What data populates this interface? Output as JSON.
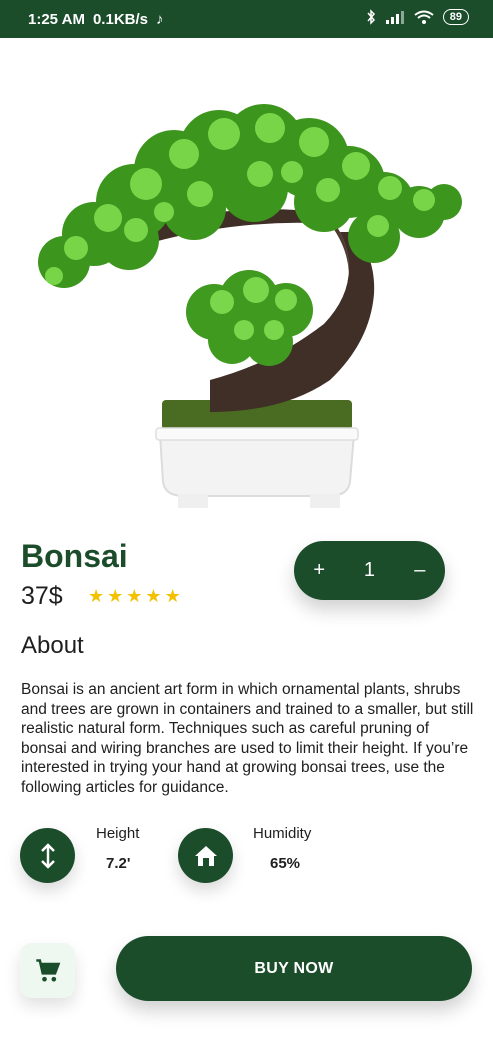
{
  "status_bar": {
    "time": "1:25 AM",
    "net_speed": "0.1KB/s",
    "battery": "89"
  },
  "product": {
    "name": "Bonsai",
    "price": "37$",
    "rating": 5,
    "quantity": "1",
    "minus_label": "–",
    "plus_label": "+"
  },
  "about": {
    "heading": "About",
    "text": "Bonsai is an ancient art form in which ornamental plants, shrubs and trees are grown in containers and trained to a smaller, but still realistic natural form. Techniques such as careful pruning of bonsai and wiring branches are used to limit their height. If you’re interested in trying your hand at growing bonsai trees, use the following articles for guidance."
  },
  "specs": {
    "height": {
      "label": "Height",
      "value": "7.2'",
      "icon": "vertical-arrows-icon"
    },
    "humidity": {
      "label": "Humidity",
      "value": "65%",
      "icon": "home-icon"
    }
  },
  "actions": {
    "buy_label": "BUY NOW",
    "cart_icon": "cart-icon"
  },
  "colors": {
    "primary": "#1b4d2b",
    "star": "#f2c200",
    "cart_bg": "#eef8f1"
  }
}
